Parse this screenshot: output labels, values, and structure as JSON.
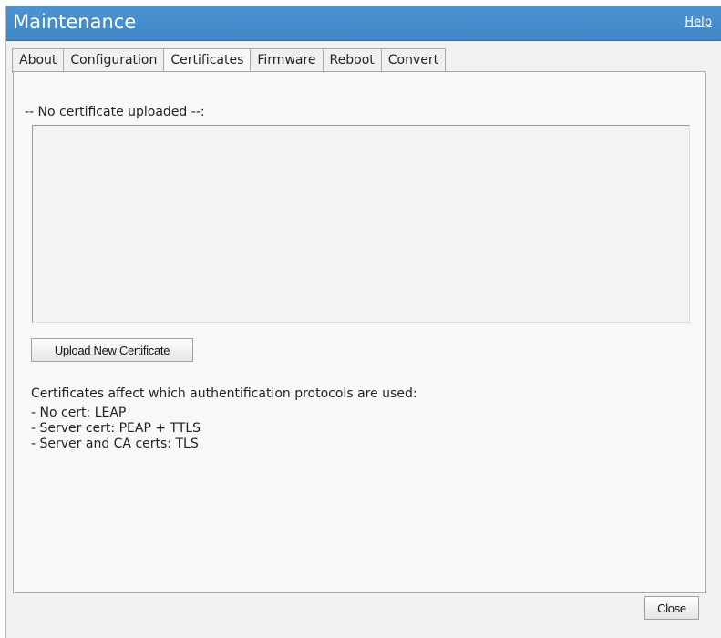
{
  "header": {
    "title": "Maintenance",
    "help_label": "Help"
  },
  "tabs": [
    {
      "label": "About"
    },
    {
      "label": "Configuration"
    },
    {
      "label": "Certificates",
      "active": true
    },
    {
      "label": "Firmware"
    },
    {
      "label": "Reboot"
    },
    {
      "label": "Convert"
    }
  ],
  "certificates": {
    "status": "-- No certificate uploaded --:",
    "content": "",
    "upload_label": "Upload New Certificate",
    "info_heading": "Certificates affect which authentification protocols are used:",
    "info_items": [
      "- No cert: LEAP",
      "- Server cert: PEAP + TTLS",
      "- Server and CA certs: TLS"
    ]
  },
  "footer": {
    "close_label": "Close"
  },
  "colors": {
    "titlebar": "#4389cb",
    "panel_bg": "#f8f8f8"
  }
}
